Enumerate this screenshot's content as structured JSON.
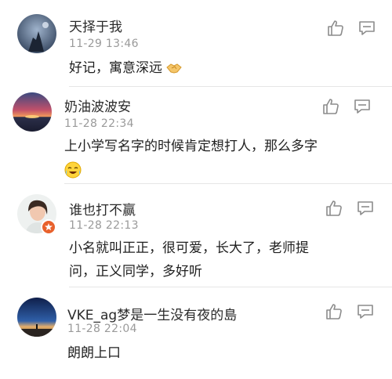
{
  "comments": [
    {
      "username": "天择于我",
      "time": "11-29 13:46",
      "text_lines": [
        "好记，寓意深远"
      ],
      "emoji": "handshake-emoji"
    },
    {
      "username": "奶油波波安",
      "time": "11-28 22:34",
      "text_lines": [
        "上小学写名字的时候肯定想打人，那么多字"
      ],
      "emoji": "laugh-cry-emoji"
    },
    {
      "username": "谁也打不赢",
      "time": "11-28 22:13",
      "text_lines": [
        "小名就叫正正，很可爱，长大了，老师提",
        "问，正义同学，多好听"
      ],
      "badge": "verified-badge"
    },
    {
      "username": "VKE_ag梦是一生没有夜的島",
      "time": "11-28 22:04",
      "text_lines": [
        "朗朗上口"
      ]
    }
  ],
  "icons": {
    "like": "thumbs-up-icon",
    "reply": "comment-icon"
  },
  "colors": {
    "name": "#2a2a2a",
    "time": "#9a9a9a",
    "icon": "#8c8c8c",
    "divider": "#e6e6e6"
  }
}
